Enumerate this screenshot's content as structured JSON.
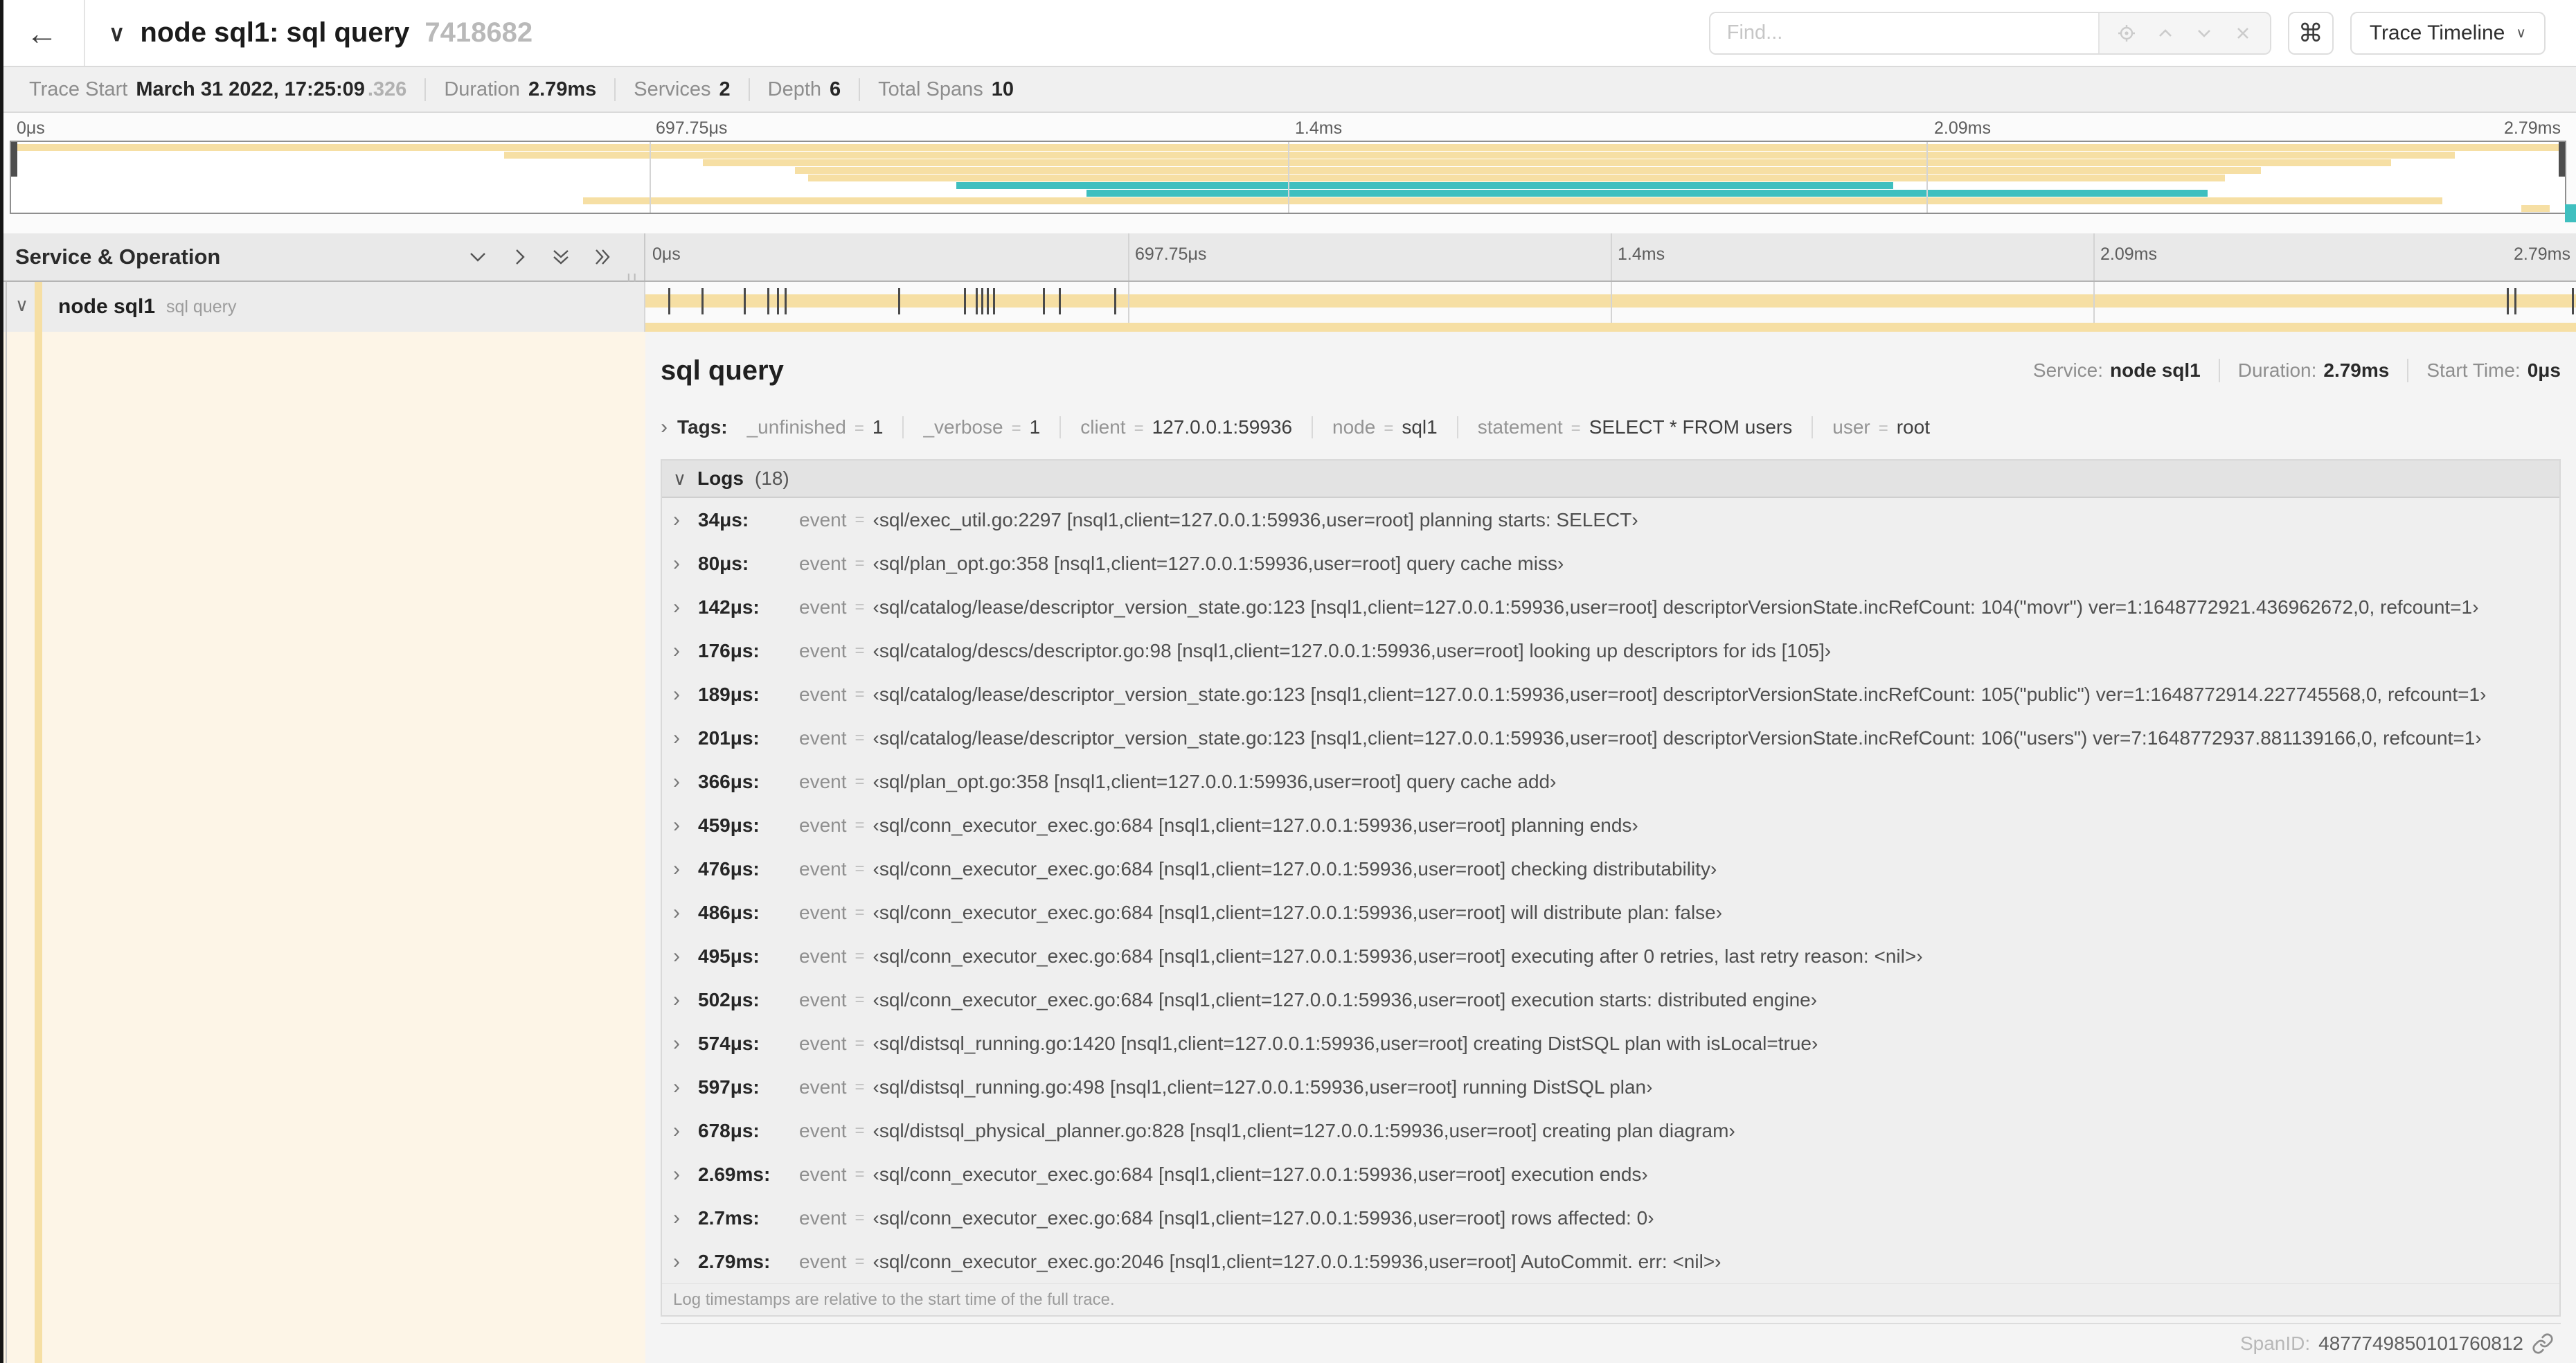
{
  "header": {
    "back_icon": "←",
    "collapse_icon": "∨",
    "title": "node sql1: sql query",
    "trace_id": "7418682",
    "find_placeholder": "Find...",
    "command_icon": "⌘",
    "view_dropdown": "Trace Timeline",
    "dropdown_caret": "∨"
  },
  "trace_info": {
    "items": [
      {
        "label": "Trace Start",
        "value": "March 31 2022, 17:25:09",
        "suffix": ".326"
      },
      {
        "label": "Duration",
        "value": "2.79ms"
      },
      {
        "label": "Services",
        "value": "2"
      },
      {
        "label": "Depth",
        "value": "6"
      },
      {
        "label": "Total Spans",
        "value": "10"
      }
    ]
  },
  "ruler": {
    "labels": [
      "0μs",
      "697.75μs",
      "1.4ms",
      "2.09ms",
      "2.79ms"
    ],
    "positions_pct": [
      0,
      25,
      50,
      75,
      100
    ],
    "gridlines_pct": [
      25,
      50,
      75
    ]
  },
  "minimap": {
    "rows": [
      {
        "start_pct": 0,
        "end_pct": 100,
        "color": "tan"
      },
      {
        "start_pct": 19.3,
        "end_pct": 95.7,
        "color": "tan"
      },
      {
        "start_pct": 27.1,
        "end_pct": 93.2,
        "color": "tan"
      },
      {
        "start_pct": 30.7,
        "end_pct": 88.1,
        "color": "tan"
      },
      {
        "start_pct": 31.2,
        "end_pct": 86.7,
        "color": "tan"
      },
      {
        "start_pct": 37.0,
        "end_pct": 73.7,
        "color": "teal"
      },
      {
        "start_pct": 42.1,
        "end_pct": 86.0,
        "color": "teal"
      },
      {
        "start_pct": 22.4,
        "end_pct": 95.2,
        "color": "tan"
      },
      {
        "start_pct": 98.3,
        "end_pct": 99.4,
        "color": "tan"
      }
    ]
  },
  "columns": {
    "left_title": "Service & Operation"
  },
  "span_row": {
    "service": "node sql1",
    "operation": "sql query",
    "tick_positions_pct": [
      1.2,
      2.9,
      5.1,
      6.3,
      6.8,
      7.2,
      13.1,
      16.5,
      17.1,
      17.4,
      17.7,
      18.0,
      20.6,
      21.4,
      24.3,
      96.4,
      96.8,
      99.8
    ]
  },
  "detail": {
    "title": "sql query",
    "service_label": "Service:",
    "service_value": "node sql1",
    "duration_label": "Duration:",
    "duration_value": "2.79ms",
    "start_label": "Start Time:",
    "start_value": "0μs",
    "tags_label": "Tags:",
    "tags": [
      {
        "key": "_unfinished",
        "value": "1"
      },
      {
        "key": "_verbose",
        "value": "1"
      },
      {
        "key": "client",
        "value": "127.0.0.1:59936"
      },
      {
        "key": "node",
        "value": "sql1"
      },
      {
        "key": "statement",
        "value": "SELECT * FROM users"
      },
      {
        "key": "user",
        "value": "root"
      }
    ],
    "logs_label": "Logs",
    "logs_count": "(18)",
    "log_key": "event",
    "logs": [
      {
        "time": "34μs:",
        "value": "‹sql/exec_util.go:2297 [nsql1,client=127.0.0.1:59936,user=root] planning starts: SELECT›"
      },
      {
        "time": "80μs:",
        "value": "‹sql/plan_opt.go:358 [nsql1,client=127.0.0.1:59936,user=root] query cache miss›"
      },
      {
        "time": "142μs:",
        "value": "‹sql/catalog/lease/descriptor_version_state.go:123 [nsql1,client=127.0.0.1:59936,user=root] descriptorVersionState.incRefCount: 104(\"movr\") ver=1:1648772921.436962672,0, refcount=1›"
      },
      {
        "time": "176μs:",
        "value": "‹sql/catalog/descs/descriptor.go:98 [nsql1,client=127.0.0.1:59936,user=root] looking up descriptors for ids [105]›"
      },
      {
        "time": "189μs:",
        "value": "‹sql/catalog/lease/descriptor_version_state.go:123 [nsql1,client=127.0.0.1:59936,user=root] descriptorVersionState.incRefCount: 105(\"public\") ver=1:1648772914.227745568,0, refcount=1›"
      },
      {
        "time": "201μs:",
        "value": "‹sql/catalog/lease/descriptor_version_state.go:123 [nsql1,client=127.0.0.1:59936,user=root] descriptorVersionState.incRefCount: 106(\"users\") ver=7:1648772937.881139166,0, refcount=1›"
      },
      {
        "time": "366μs:",
        "value": "‹sql/plan_opt.go:358 [nsql1,client=127.0.0.1:59936,user=root] query cache add›"
      },
      {
        "time": "459μs:",
        "value": "‹sql/conn_executor_exec.go:684 [nsql1,client=127.0.0.1:59936,user=root] planning ends›"
      },
      {
        "time": "476μs:",
        "value": "‹sql/conn_executor_exec.go:684 [nsql1,client=127.0.0.1:59936,user=root] checking distributability›"
      },
      {
        "time": "486μs:",
        "value": "‹sql/conn_executor_exec.go:684 [nsql1,client=127.0.0.1:59936,user=root] will distribute plan: false›"
      },
      {
        "time": "495μs:",
        "value": "‹sql/conn_executor_exec.go:684 [nsql1,client=127.0.0.1:59936,user=root] executing after 0 retries, last retry reason: <nil>›"
      },
      {
        "time": "502μs:",
        "value": "‹sql/conn_executor_exec.go:684 [nsql1,client=127.0.0.1:59936,user=root] execution starts: distributed engine›"
      },
      {
        "time": "574μs:",
        "value": "‹sql/distsql_running.go:1420 [nsql1,client=127.0.0.1:59936,user=root] creating DistSQL plan with isLocal=true›"
      },
      {
        "time": "597μs:",
        "value": "‹sql/distsql_running.go:498 [nsql1,client=127.0.0.1:59936,user=root] running DistSQL plan›"
      },
      {
        "time": "678μs:",
        "value": "‹sql/distsql_physical_planner.go:828 [nsql1,client=127.0.0.1:59936,user=root] creating plan diagram›"
      },
      {
        "time": "2.69ms:",
        "value": "‹sql/conn_executor_exec.go:684 [nsql1,client=127.0.0.1:59936,user=root] execution ends›"
      },
      {
        "time": "2.7ms:",
        "value": "‹sql/conn_executor_exec.go:684 [nsql1,client=127.0.0.1:59936,user=root] rows affected: 0›"
      },
      {
        "time": "2.79ms:",
        "value": "‹sql/conn_executor_exec.go:2046 [nsql1,client=127.0.0.1:59936,user=root] AutoCommit. err: <nil>›"
      }
    ],
    "note": "Log timestamps are relative to the start time of the full trace.",
    "spanid_label": "SpanID:",
    "spanid_value": "4877749850101760812"
  },
  "colors": {
    "tan": "#f6dfa4",
    "teal": "#3fbfbf",
    "cream": "#fdf5e7"
  }
}
